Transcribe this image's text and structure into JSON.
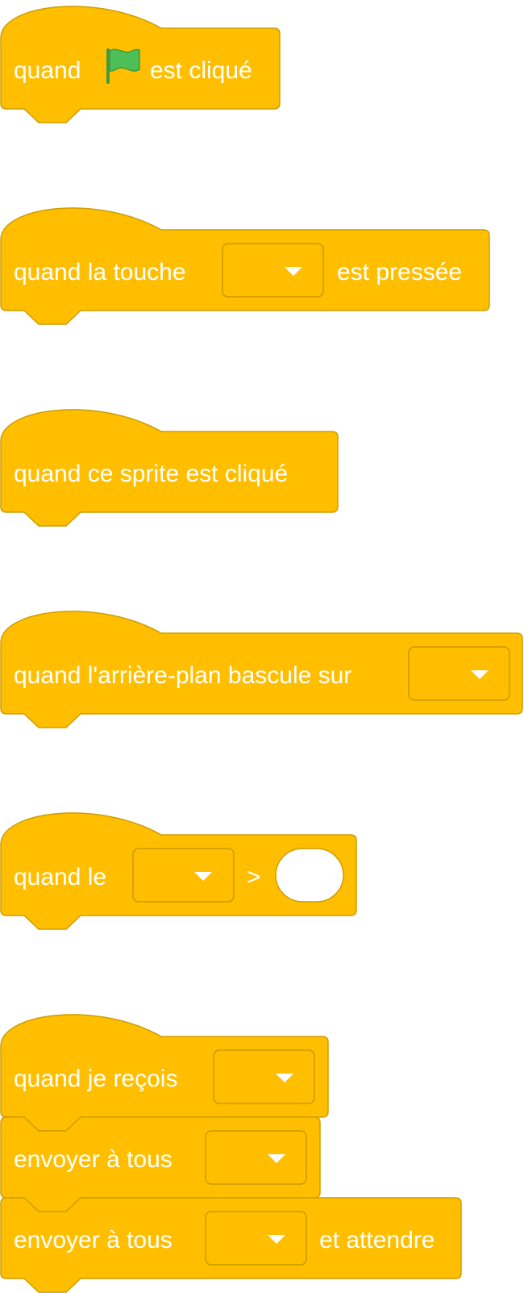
{
  "colors": {
    "events_block": "#ffbf00",
    "events_border": "#cf9d00",
    "flag_green": "#4cbf56",
    "text": "#ffffff",
    "background": "#ffffff"
  },
  "blocks": {
    "flag_clicked": {
      "word_when": "quand",
      "flag_icon": "green-flag-icon",
      "word_clicked": "est cliqué"
    },
    "key_pressed": {
      "prefix": "quand la touche",
      "key_value": "",
      "suffix": "est pressée"
    },
    "sprite_clicked": {
      "label": "quand ce sprite est cliqué"
    },
    "backdrop_switches": {
      "prefix": "quand l'arrière-plan bascule sur",
      "backdrop_value": ""
    },
    "greater_than": {
      "prefix": "quand le",
      "sensor_value": "",
      "operator": ">",
      "number_value": ""
    },
    "receive": {
      "prefix": "quand je reçois",
      "message_value": ""
    },
    "broadcast": {
      "prefix": "envoyer à tous",
      "message_value": ""
    },
    "broadcast_wait": {
      "prefix": "envoyer à tous",
      "message_value": "",
      "suffix": "et attendre"
    }
  }
}
